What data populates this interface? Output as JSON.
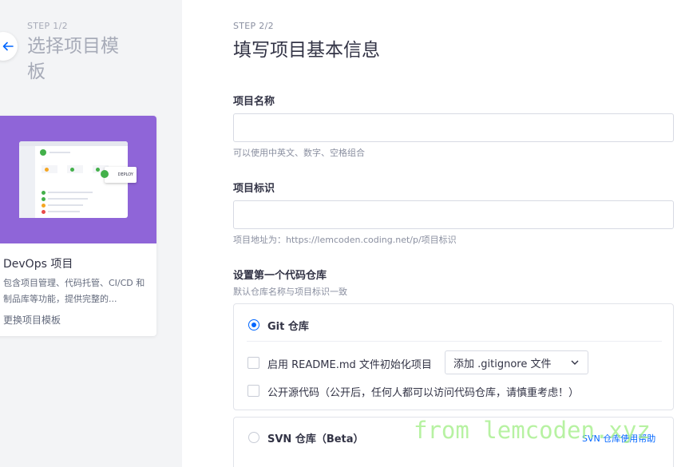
{
  "left_panel": {
    "step": "STEP 1/2",
    "title": "选择项目模板",
    "template": {
      "name": "DevOps 项目",
      "description": "包含项目管理、代码托管、CI/CD 和制品库等功能，提供完整的...",
      "deploy_badge": "DEPLOY",
      "change_link": "更换项目模板",
      "banner_color": "#8f65d8"
    }
  },
  "main": {
    "step": "STEP 2/2",
    "title": "填写项目基本信息",
    "project_name": {
      "label": "项目名称",
      "value": "",
      "hint": "可以使用中英文、数字、空格组合"
    },
    "project_id": {
      "label": "项目标识",
      "value": "",
      "hint": "项目地址为：https://lemcoden.coding.net/p/项目标识"
    },
    "repo": {
      "label": "设置第一个代码仓库",
      "hint": "默认仓库名称与项目标识一致",
      "git": {
        "label": "Git 仓库",
        "selected": true,
        "readme_label": "启用 README.md 文件初始化项目",
        "gitignore_select": "添加 .gitignore 文件",
        "public_label": "公开源代码（公开后，任何人都可以访问代码仓库，请慎重考虑！）"
      },
      "svn": {
        "label": "SVN 仓库（Beta）",
        "selected": false,
        "help_link": "SVN 仓库使用帮助"
      }
    }
  },
  "watermark": "from lemcoden.xyz",
  "colors": {
    "accent": "#0066ff",
    "text": "#323345",
    "muted": "#8a8fa0"
  }
}
